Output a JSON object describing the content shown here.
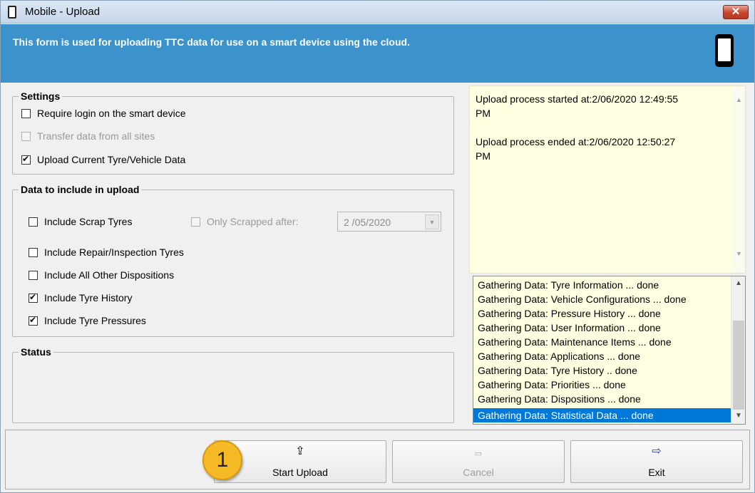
{
  "window": {
    "title": "Mobile - Upload",
    "close_label": "✕"
  },
  "banner": {
    "text": "This form is used for uploading TTC data for use on a smart device using the cloud."
  },
  "settings": {
    "title": "Settings",
    "options": [
      {
        "label": "Require login on the smart device",
        "checked": false,
        "enabled": true
      },
      {
        "label": "Transfer data from all sites",
        "checked": false,
        "enabled": false
      },
      {
        "label": "Upload Current Tyre/Vehicle Data",
        "checked": true,
        "enabled": true
      }
    ]
  },
  "data_include": {
    "title": "Data to include in upload",
    "options": [
      {
        "label": "Include Scrap Tyres",
        "checked": false,
        "enabled": true
      },
      {
        "label": "Include Repair/Inspection Tyres",
        "checked": false,
        "enabled": true
      },
      {
        "label": "Include All Other Dispositions",
        "checked": false,
        "enabled": true
      },
      {
        "label": "Include Tyre History",
        "checked": true,
        "enabled": true
      },
      {
        "label": "Include Tyre Pressures",
        "checked": true,
        "enabled": true
      }
    ],
    "only_scrapped_after": {
      "label": "Only Scrapped after:",
      "checked": false,
      "enabled": false,
      "date": "2 /05/2020"
    }
  },
  "status": {
    "title": "Status"
  },
  "log": {
    "lines": [
      "Upload process started at:2/06/2020 12:49:55",
      "PM",
      "Upload process ended at:2/06/2020 12:50:27",
      "PM"
    ]
  },
  "progress_list": {
    "items": [
      "Gathering Data: Tyre Information ... done",
      "Gathering Data: Vehicle Configurations ... done",
      "Gathering Data: Pressure History ... done",
      "Gathering Data: User Information ... done",
      "Gathering Data: Maintenance Items ... done",
      "Gathering Data: Applications ... done",
      "Gathering Data: Tyre History .. done",
      "Gathering Data: Priorities ... done",
      "Gathering Data: Dispositions ... done",
      "Gathering Data: Statistical Data ... done"
    ],
    "selected_index": 9
  },
  "buttons": {
    "start_upload": "Start Upload",
    "cancel": "Cancel",
    "exit": "Exit"
  },
  "badge": {
    "number": "1"
  },
  "icons": {
    "phone": "smartphone-icon",
    "upload": "cloud-upload-icon",
    "cancel": "cancel-icon",
    "exit": "exit-door-icon"
  },
  "colors": {
    "banner": "#3c92cb",
    "selection": "#0078d7",
    "log_bg": "#ffffe1",
    "badge": "#f6b926"
  }
}
